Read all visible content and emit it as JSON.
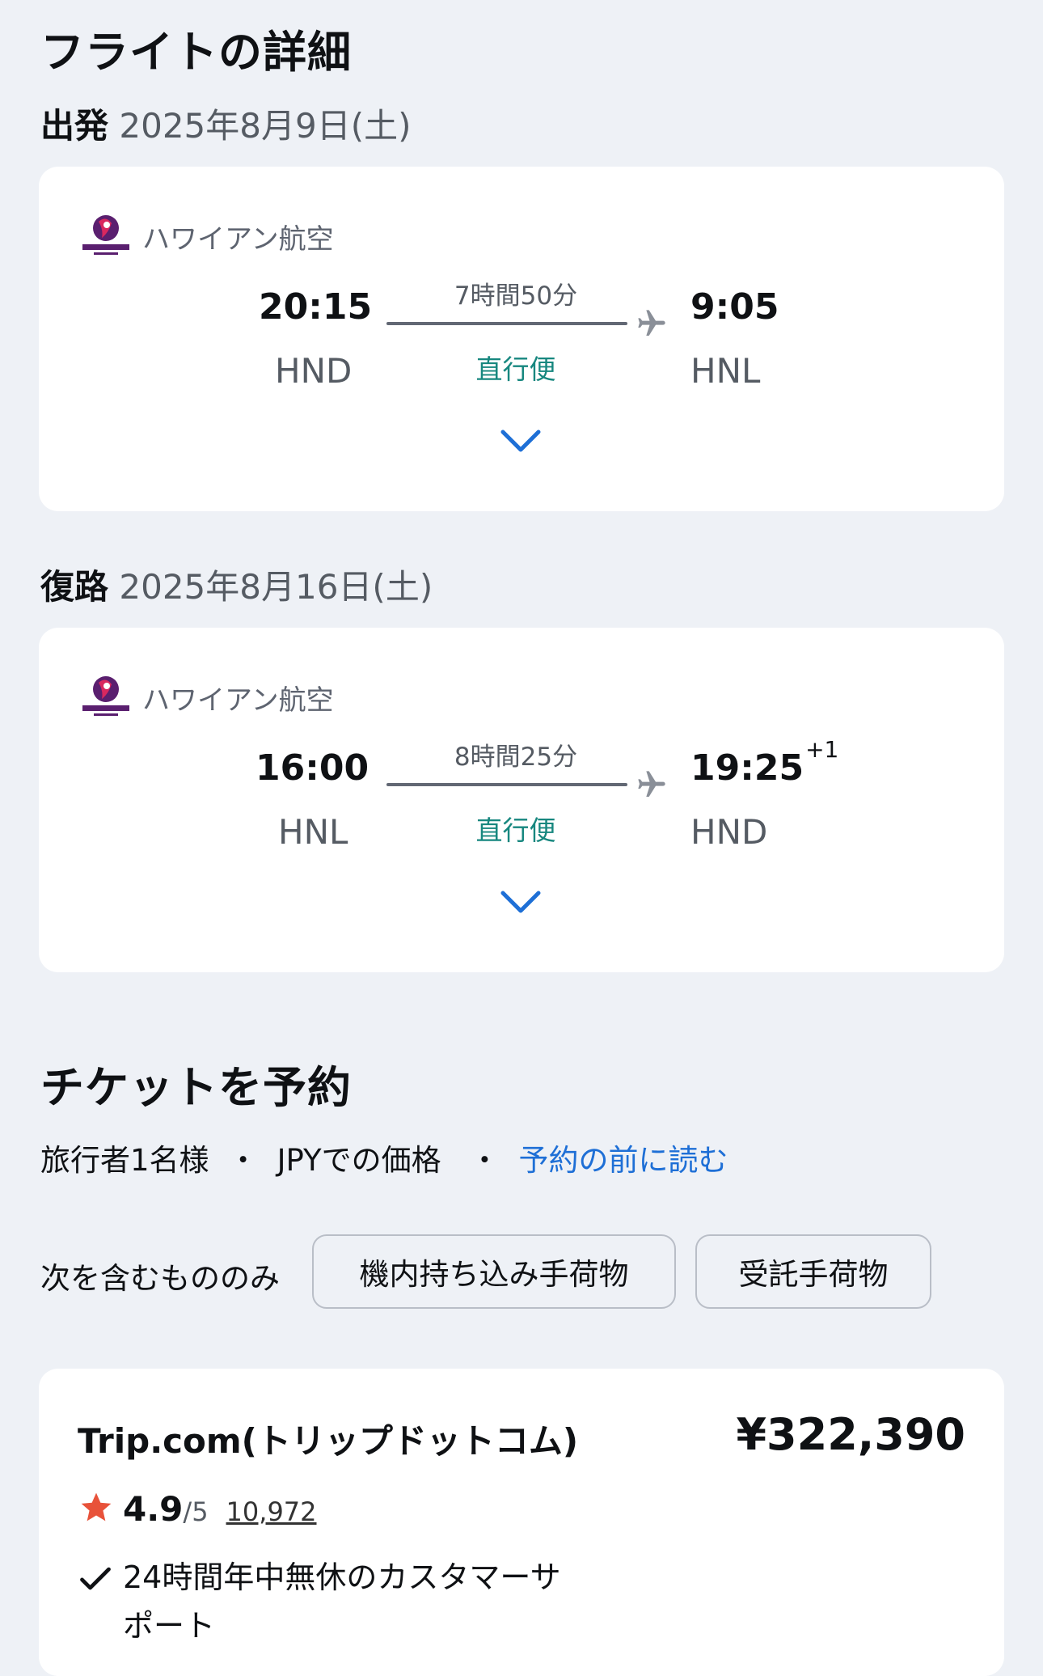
{
  "page_title": "フライトの詳細",
  "outbound": {
    "label": "出発",
    "date": "2025年8月9日(土)",
    "airline": "ハワイアン航空",
    "dep_time": "20:15",
    "dep_code": "HND",
    "duration": "7時間50分",
    "stops": "直行便",
    "arr_time": "9:05",
    "arr_code": "HNL",
    "day_offset": ""
  },
  "return": {
    "label": "復路",
    "date": "2025年8月16日(土)",
    "airline": "ハワイアン航空",
    "dep_time": "16:00",
    "dep_code": "HNL",
    "duration": "8時間25分",
    "stops": "直行便",
    "arr_time": "19:25",
    "arr_code": "HND",
    "day_offset": "+1"
  },
  "booking": {
    "title": "チケットを予約",
    "travelers": "旅行者1名様",
    "currency_note": "JPYでの価格",
    "read_link": "予約の前に読む",
    "filter_label": "次を含むもののみ",
    "chips": [
      "機内持ち込み手荷物",
      "受託手荷物"
    ]
  },
  "offer": {
    "provider": "Trip.com(トリップドットコム)",
    "price": "¥322,390",
    "rating": "4.9",
    "rating_max": "/5",
    "review_count": "10,972",
    "feature": "24時間年中無休のカスタマーサポート",
    "feature_line1": "24時間年中無休のカスタマーサ",
    "feature_line2": "ポート"
  },
  "colors": {
    "background": "#eef1f6",
    "accent_link": "#1e6fd6",
    "direct_green": "#17877f",
    "star": "#e8523a",
    "airline_logo": "#5a1f6f"
  },
  "icons": [
    "hawaiian-airlines-logo",
    "plane-icon",
    "chevron-down-icon",
    "star-icon",
    "check-icon"
  ]
}
